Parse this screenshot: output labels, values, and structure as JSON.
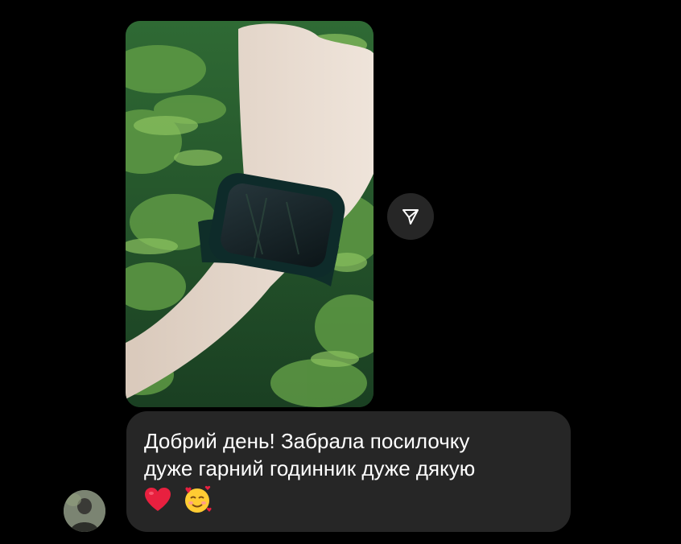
{
  "message": {
    "line1": "Добрий день! Забрала посилочку",
    "line2": "дуже гарний годинник дуже дякую",
    "emoji_1": "red-heart",
    "emoji_2": "smiling-face-with-hearts"
  },
  "photo": {
    "subject": "watch-on-wrist"
  },
  "share_icon": "paper-plane-icon",
  "colors": {
    "background": "#000000",
    "bubble": "#262626",
    "text": "#ffffff",
    "heart": "#e8203f"
  }
}
